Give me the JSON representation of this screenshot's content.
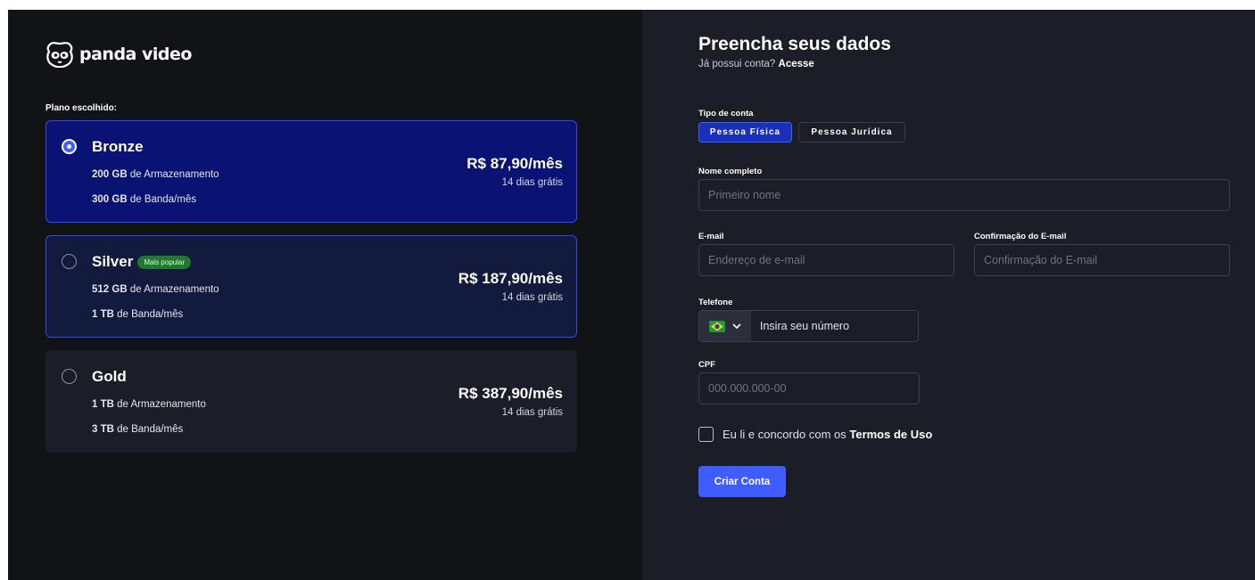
{
  "brand": {
    "name": "panda video"
  },
  "plans": {
    "heading": "Plano escolhido:",
    "items": [
      {
        "name": "Bronze",
        "storage_amount": "200 GB",
        "storage_text": " de Armazenamento",
        "bandwidth_amount": "300 GB",
        "bandwidth_text": " de Banda/mês",
        "price": "R$ 87,90/mês",
        "trial": "14 dias grátis",
        "badge": "",
        "selected": true
      },
      {
        "name": "Silver",
        "storage_amount": "512 GB",
        "storage_text": " de Armazenamento",
        "bandwidth_amount": "1 TB",
        "bandwidth_text": " de Banda/mês",
        "price": "R$ 187,90/mês",
        "trial": "14 dias grátis",
        "badge": "Mais popular",
        "selected": false
      },
      {
        "name": "Gold",
        "storage_amount": "1 TB",
        "storage_text": " de Armazenamento",
        "bandwidth_amount": "3 TB",
        "bandwidth_text": " de Banda/mês",
        "price": "R$ 387,90/mês",
        "trial": "14 dias grátis",
        "badge": "",
        "selected": false
      }
    ]
  },
  "form": {
    "title": "Preencha seus dados",
    "login_prompt": "Já possui conta?",
    "login_link": "Acesse",
    "account_type": {
      "label": "Tipo de conta",
      "options": [
        "Pessoa Física",
        "Pessoa Jurídica"
      ],
      "selected": "Pessoa Física"
    },
    "full_name": {
      "label": "Nome completo",
      "placeholder": "Primeiro nome",
      "value": ""
    },
    "email": {
      "label": "E-mail",
      "placeholder": "Endereço de e-mail",
      "value": ""
    },
    "email_confirm": {
      "label": "Confirmação do E-mail",
      "placeholder": "Confirmação do E-mail",
      "value": ""
    },
    "phone": {
      "label": "Telefone",
      "placeholder": "Insira seu número",
      "country_icon": "brazil-flag-icon"
    },
    "cpf": {
      "label": "CPF",
      "placeholder": "000.000.000-00",
      "value": ""
    },
    "terms": {
      "text": "Eu li e concordo com os",
      "link": "Termos de Uso",
      "checked": false
    },
    "submit_label": "Criar Conta"
  },
  "colors": {
    "accent": "#3f5cff",
    "selected_card": "#0a1374",
    "badge": "#1e7a2e",
    "left_bg": "#121316",
    "right_bg": "#1b1d27"
  }
}
